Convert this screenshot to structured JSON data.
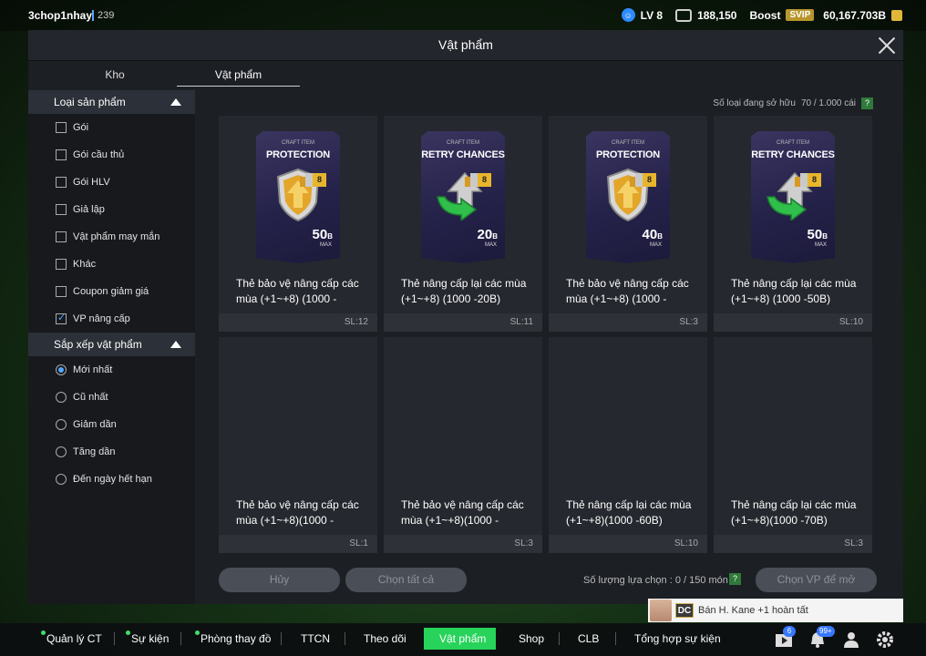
{
  "topbar": {
    "username": "3chop1nhay",
    "user_level": "239",
    "level_label": "LV 8",
    "currency_1": "188,150",
    "boost_label": "Boost",
    "svip_label": "SVIP",
    "currency_2": "60,167.703B"
  },
  "modal": {
    "title": "Vật phẩm",
    "tabs": [
      {
        "label": "Kho"
      },
      {
        "label": "Vật phẩm"
      }
    ],
    "owned_label": "Số loại đang sở hữu",
    "owned_value": "70 / 1.000 cái",
    "help": "?"
  },
  "filters": {
    "type_header": "Loại sản phẩm",
    "types": [
      {
        "label": "Gói",
        "checked": false
      },
      {
        "label": "Gói cầu thủ",
        "checked": false
      },
      {
        "label": "Gói HLV",
        "checked": false
      },
      {
        "label": "Giả lập",
        "checked": false
      },
      {
        "label": "Vật phẩm may mắn",
        "checked": false
      },
      {
        "label": "Khác",
        "checked": false
      },
      {
        "label": "Coupon giảm giá",
        "checked": false
      },
      {
        "label": "VP nâng cấp",
        "checked": true
      }
    ],
    "sort_header": "Sắp xếp vật phẩm",
    "sorts": [
      {
        "label": "Mới nhất",
        "checked": true
      },
      {
        "label": "Cũ nhất",
        "checked": false
      },
      {
        "label": "Giảm dần",
        "checked": false
      },
      {
        "label": "Tăng dần",
        "checked": false
      },
      {
        "label": "Đến ngày hết hạn",
        "checked": false
      }
    ]
  },
  "items": [
    {
      "art_small": "CRAFT ITEM",
      "art_title": "PROTECTION",
      "art_value": "50",
      "art_unit": "B",
      "art_max": "MAX",
      "art_level": "8",
      "label_line1": "Thẻ bảo vệ nâng cấp các",
      "label_line2": "mùa (+1~+8) (1000 -",
      "qty": "SL:12"
    },
    {
      "art_small": "CRAFT ITEM",
      "art_title": "RETRY CHANCES",
      "art_value": "20",
      "art_unit": "B",
      "art_max": "MAX",
      "art_level": "8",
      "label_line1": "Thẻ nâng cấp lại các mùa",
      "label_line2": "(+1~+8) (1000 -20B)",
      "qty": "SL:11"
    },
    {
      "art_small": "CRAFT ITEM",
      "art_title": "PROTECTION",
      "art_value": "40",
      "art_unit": "B",
      "art_max": "MAX",
      "art_level": "8",
      "label_line1": "Thẻ bảo vệ nâng cấp các",
      "label_line2": "mùa (+1~+8) (1000 -",
      "qty": "SL:3"
    },
    {
      "art_small": "CRAFT ITEM",
      "art_title": "RETRY CHANCES",
      "art_value": "50",
      "art_unit": "B",
      "art_max": "MAX",
      "art_level": "8",
      "label_line1": "Thẻ nâng cấp lại các mùa",
      "label_line2": "(+1~+8) (1000 -50B)",
      "qty": "SL:10"
    },
    {
      "label_line1": "Thẻ bảo vệ nâng cấp các",
      "label_line2": "mùa (+1~+8)(1000 -",
      "qty": "SL:1"
    },
    {
      "label_line1": "Thẻ bảo vệ nâng cấp các",
      "label_line2": "mùa (+1~+8)(1000 -",
      "qty": "SL:3"
    },
    {
      "label_line1": "Thẻ nâng cấp lại các mùa",
      "label_line2": "(+1~+8)(1000 -60B)",
      "qty": "SL:10"
    },
    {
      "label_line1": "Thẻ nâng cấp lại các mùa",
      "label_line2": "(+1~+8)(1000 -70B)",
      "qty": "SL:3"
    }
  ],
  "actions": {
    "cancel": "Hủy",
    "select_all": "Chọn tất cả",
    "selection_label": "Số lượng lựa chọn : 0 / 150 món",
    "open": "Chọn VP để mở"
  },
  "toast": {
    "badge": "DC",
    "text": "Bán H. Kane +1 hoàn tất"
  },
  "nav": {
    "items": [
      {
        "label": "Quản lý CT"
      },
      {
        "label": "Sự kiện"
      },
      {
        "label": "Phòng thay đồ"
      },
      {
        "label": "TTCN"
      },
      {
        "label": "Theo dõi"
      },
      {
        "label": "Vật phẩm"
      },
      {
        "label": "Shop"
      },
      {
        "label": "CLB"
      },
      {
        "label": "Tổng hợp sự kiện"
      }
    ],
    "badge_events": "6",
    "badge_notifications": "99+"
  },
  "colors": {
    "accent_green": "#27d35a",
    "accent_blue": "#55a8ff",
    "card_bg": "#25282e"
  }
}
